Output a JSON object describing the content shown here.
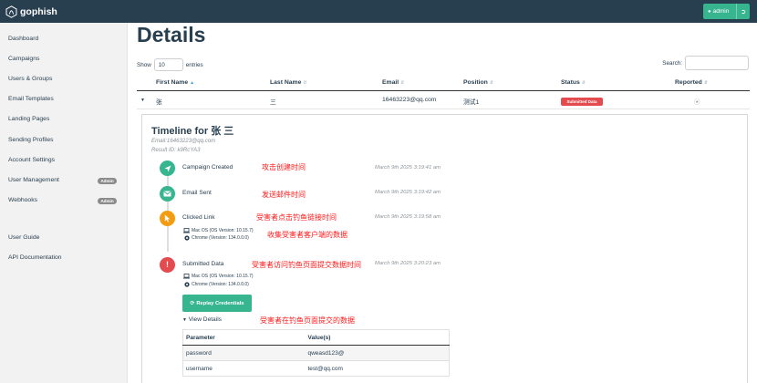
{
  "app": {
    "brand": "gophish",
    "user_button": "admin"
  },
  "sidebar": {
    "items": [
      {
        "label": "Dashboard"
      },
      {
        "label": "Campaigns"
      },
      {
        "label": "Users & Groups"
      },
      {
        "label": "Email Templates"
      },
      {
        "label": "Landing Pages"
      },
      {
        "label": "Sending Profiles"
      },
      {
        "label": "Account Settings"
      },
      {
        "label": "User Management",
        "badge": "Admin"
      },
      {
        "label": "Webhooks",
        "badge": "Admin"
      },
      {
        "label": "User Guide"
      },
      {
        "label": "API Documentation"
      }
    ]
  },
  "page": {
    "title": "Details",
    "show_label": "Show",
    "show_value": "10",
    "entries_label": "entries",
    "search_label": "Search:"
  },
  "table": {
    "headers": [
      "First Name",
      "Last Name",
      "Email",
      "Position",
      "Status",
      "Reported"
    ],
    "row": {
      "first_name": "张",
      "last_name": "三",
      "email": "16463223@qq.com",
      "position": "测试1",
      "status": "Submitted Data"
    }
  },
  "timeline": {
    "title": "Timeline for 张 三",
    "email_line": "Email:16463223@qq.com",
    "rid_line": "Result ID: k9RcYA3",
    "events": [
      {
        "label": "Campaign Created",
        "time": "March 9th 2025 3:19:41 am",
        "note": "攻击创建时间",
        "color": "#37b58f",
        "icon": "rocket-icon"
      },
      {
        "label": "Email Sent",
        "time": "March 9th 2025 3:19:42 am",
        "note": "发送邮件时间",
        "color": "#37b58f",
        "icon": "envelope-icon"
      },
      {
        "label": "Clicked Link",
        "time": "March 9th 2025 3:19:58 am",
        "note": "受害者点击钓鱼链接时间",
        "color": "#f39c12",
        "icon": "mouse-pointer-icon"
      },
      {
        "label": "Submitted Data",
        "time": "March 9th 2025 3:20:23 am",
        "note": "受害者访问钓鱼页面提交数据时间",
        "color": "#e34b4f",
        "icon": "exclamation-icon"
      }
    ],
    "clicked_os": "Mac OS (OS Version: 10.15.7)",
    "clicked_browser": "Chrome (Version: 134.0.0.0)",
    "clicked_note": "收集受害者客户端的数据",
    "submitted_os": "Mac OS (OS Version: 10.15.7)",
    "submitted_browser": "Chrome (Version: 134.0.0.0)",
    "replay_button": "Replay Credentials",
    "view_details": "View Details",
    "view_details_note": "受害者在钓鱼页面提交的数据",
    "params_headers": [
      "Parameter",
      "Value(s)"
    ],
    "params": [
      {
        "name": "password",
        "value": "qweasd123@"
      },
      {
        "name": "username",
        "value": "test@qq.com"
      }
    ]
  },
  "colors": {
    "navbar": "#283f50",
    "accent_green": "#37b58f",
    "danger": "#e34b4f",
    "warning": "#f39c12",
    "annotation": "#ff1a1a"
  }
}
